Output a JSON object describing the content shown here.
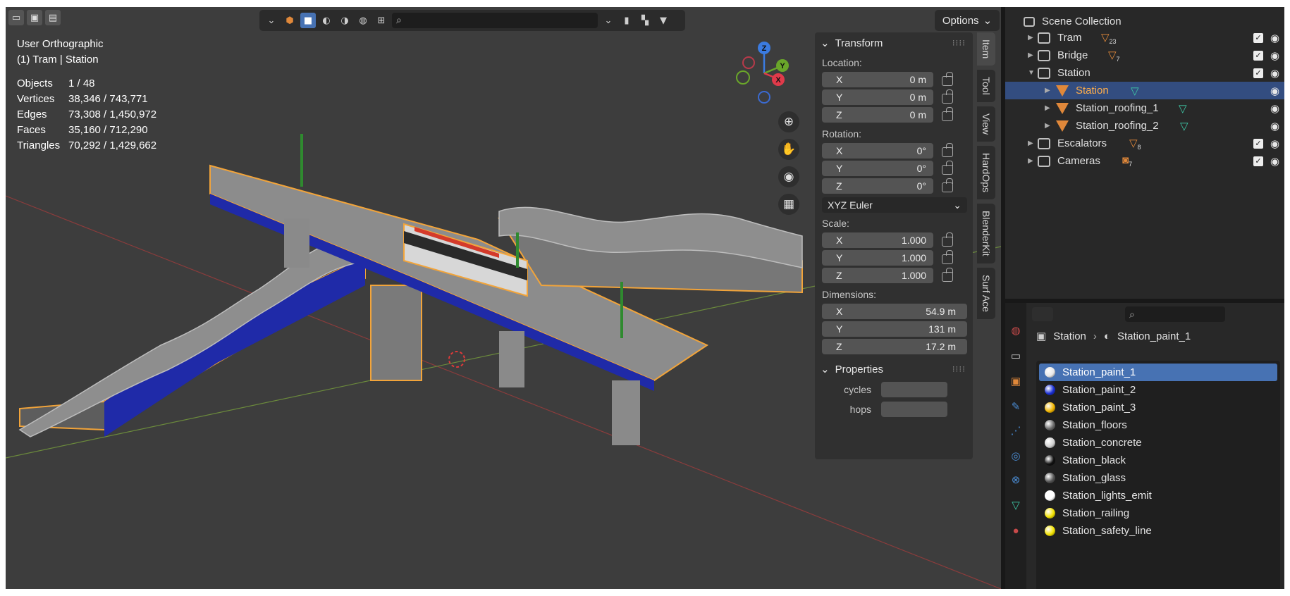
{
  "viewport": {
    "view_name": "User Orthographic",
    "context": "(1) Tram | Station",
    "stats": [
      {
        "label": "Objects",
        "value": "1 / 48"
      },
      {
        "label": "Vertices",
        "value": "38,346 / 743,771"
      },
      {
        "label": "Edges",
        "value": "73,308 / 1,450,972"
      },
      {
        "label": "Faces",
        "value": "35,160 / 712,290"
      },
      {
        "label": "Triangles",
        "value": "70,292 / 1,429,662"
      }
    ],
    "options_label": "Options",
    "gizmo": {
      "z": "Z",
      "y": "Y",
      "x": "X"
    }
  },
  "npanel": {
    "transform_title": "Transform",
    "location_label": "Location:",
    "location": [
      {
        "axis": "X",
        "value": "0 m"
      },
      {
        "axis": "Y",
        "value": "0 m"
      },
      {
        "axis": "Z",
        "value": "0 m"
      }
    ],
    "rotation_label": "Rotation:",
    "rotation": [
      {
        "axis": "X",
        "value": "0°"
      },
      {
        "axis": "Y",
        "value": "0°"
      },
      {
        "axis": "Z",
        "value": "0°"
      }
    ],
    "rotation_mode": "XYZ Euler",
    "scale_label": "Scale:",
    "scale": [
      {
        "axis": "X",
        "value": "1.000"
      },
      {
        "axis": "Y",
        "value": "1.000"
      },
      {
        "axis": "Z",
        "value": "1.000"
      }
    ],
    "dimensions_label": "Dimensions:",
    "dimensions": [
      {
        "axis": "X",
        "value": "54.9 m"
      },
      {
        "axis": "Y",
        "value": "131 m"
      },
      {
        "axis": "Z",
        "value": "17.2 m"
      }
    ],
    "properties_title": "Properties",
    "props": [
      {
        "label": "cycles"
      },
      {
        "label": "hops"
      }
    ]
  },
  "side_tabs": [
    "Item",
    "Tool",
    "View",
    "HardOps",
    "BlenderKit",
    "Surf Ace"
  ],
  "outliner": {
    "root": "Scene Collection",
    "rows": [
      {
        "label": "Tram",
        "type": "collection",
        "badge_count": "23"
      },
      {
        "label": "Bridge",
        "type": "collection",
        "badge_count": "7"
      },
      {
        "label": "Station",
        "type": "collection",
        "badge_count": ""
      },
      {
        "label": "Station",
        "type": "mesh",
        "badge_count": ""
      },
      {
        "label": "Station_roofing_1",
        "type": "mesh",
        "badge_count": ""
      },
      {
        "label": "Station_roofing_2",
        "type": "mesh",
        "badge_count": ""
      },
      {
        "label": "Escalators",
        "type": "collection",
        "badge_count": "8"
      },
      {
        "label": "Cameras",
        "type": "collection",
        "badge_count": "7"
      }
    ]
  },
  "properties": {
    "object": "Station",
    "material": "Station_paint_1",
    "slots": [
      {
        "name": "Station_paint_1",
        "color": "#e8e8e8"
      },
      {
        "name": "Station_paint_2",
        "color": "#1a2fd4"
      },
      {
        "name": "Station_paint_3",
        "color": "#f0b400"
      },
      {
        "name": "Station_floors",
        "color": "#6a6a6a"
      },
      {
        "name": "Station_concrete",
        "color": "#cfcfcf"
      },
      {
        "name": "Station_black",
        "color": "#111111"
      },
      {
        "name": "Station_glass",
        "color": "#555555"
      },
      {
        "name": "Station_lights_emit",
        "color": "#ffffff"
      },
      {
        "name": "Station_railing",
        "color": "#f2e200"
      },
      {
        "name": "Station_safety_line",
        "color": "#f2e200"
      }
    ]
  },
  "colors": {
    "accent": "#4772b3",
    "selection_outline": "#f5a623",
    "outliner_active": "#ffae4a"
  }
}
